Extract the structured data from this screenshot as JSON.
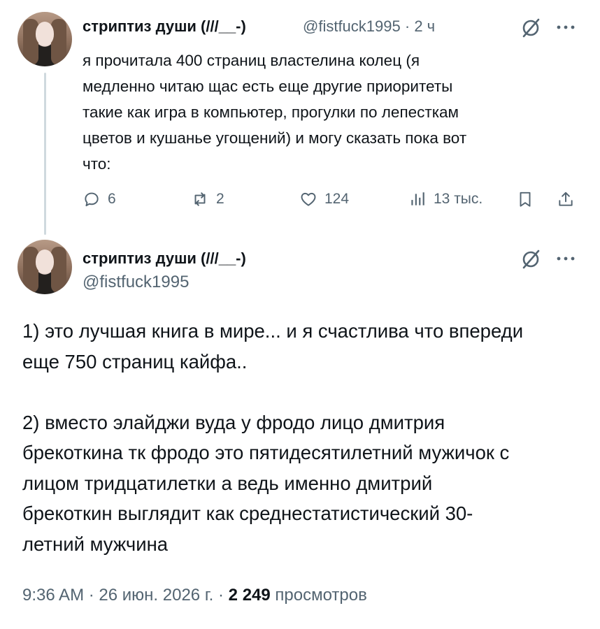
{
  "tweet1": {
    "author_name": "стриптиз души (///__-)",
    "handle": "@fistfuck1995",
    "separator": "·",
    "time": "2 ч",
    "text": "я прочитала 400 страниц властелина колец (я\nмедленно читаю щас есть еще другие приоритеты\nтакие как игра в компьютер, прогулки по лепесткам\nцветов и кушанье угощений) и могу сказать пока вот\nчто:",
    "actions": {
      "replies": "6",
      "reposts": "2",
      "likes": "124",
      "views": "13 тыс."
    }
  },
  "tweet2": {
    "author_name": "стриптиз души (///__-)",
    "handle": "@fistfuck1995",
    "text": "1) это лучшая книга в мире... и я счастлива что впереди\nеще 750 страниц кайфа..\n\n2) вместо элайджи вуда у фродо лицо дмитрия\nбрекоткина тк фродо это пятидесятилетний мужичок с\nлицом тридцатилетки а ведь именно дмитрий\nбрекоткин выглядит как среднестатистический 30-\nлетний мужчина",
    "meta": {
      "time": "9:36 AM",
      "sep1": "·",
      "date": "26 июн. 2026 г.",
      "sep2": "·",
      "views_count": "2 249",
      "views_label": "просмотров"
    }
  },
  "icons": {
    "reply": "reply-icon",
    "repost": "repost-icon",
    "like": "heart-icon",
    "views": "analytics-icon",
    "bookmark": "bookmark-icon",
    "share": "share-icon",
    "grok": "grok-icon",
    "more": "more-icon"
  },
  "colors": {
    "text": "#0f1419",
    "secondary": "#536471",
    "thread_line": "#cfd9de"
  }
}
